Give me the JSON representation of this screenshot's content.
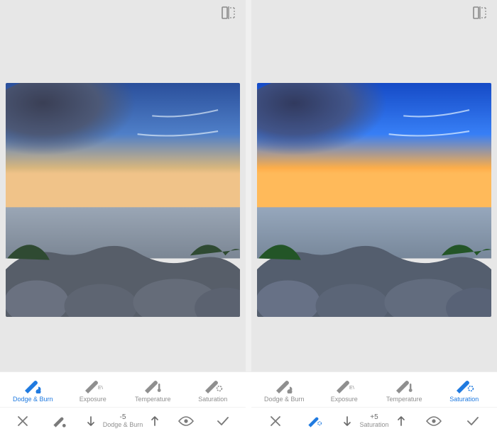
{
  "colors": {
    "accent": "#1f7ae0",
    "muted": "#8f8f8f"
  },
  "panes": {
    "left": {
      "active_tool_index": 0,
      "brush_active": false
    },
    "right": {
      "active_tool_index": 3,
      "brush_active": true
    }
  },
  "tools": [
    {
      "label": "Dodge & Burn",
      "icon": "brush-contrast-icon"
    },
    {
      "label": "Exposure",
      "icon": "brush-exposure-icon"
    },
    {
      "label": "Temperature",
      "icon": "brush-temperature-icon"
    },
    {
      "label": "Saturation",
      "icon": "brush-saturation-icon"
    }
  ],
  "bottom": {
    "left": {
      "stepper_value": "-5",
      "stepper_label": "Dodge & Burn"
    },
    "right": {
      "stepper_value": "+5",
      "stepper_label": "Saturation"
    }
  }
}
